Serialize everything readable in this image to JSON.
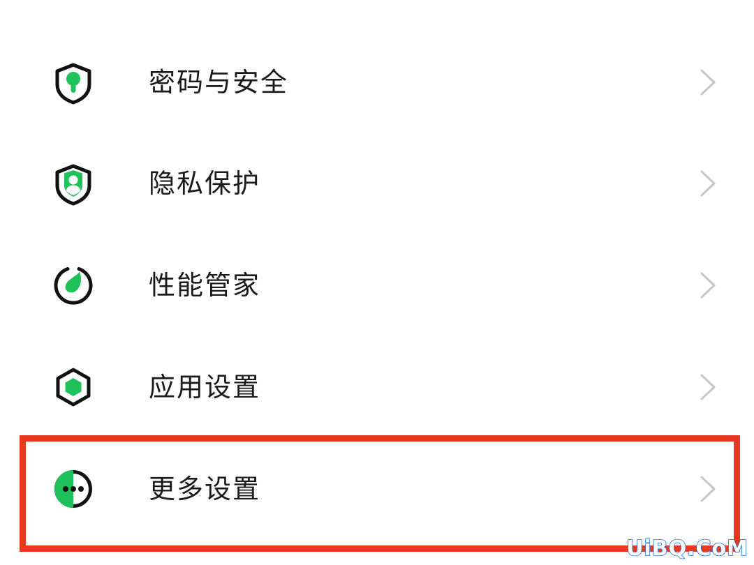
{
  "settings_list": {
    "items": [
      {
        "label": "密码与安全",
        "icon": "shield-keyhole-icon"
      },
      {
        "label": "隐私保护",
        "icon": "shield-person-icon"
      },
      {
        "label": "性能管家",
        "icon": "gauge-leaf-icon"
      },
      {
        "label": "应用设置",
        "icon": "hexagon-icon"
      },
      {
        "label": "更多设置",
        "icon": "more-dots-icon"
      }
    ]
  },
  "highlighted_item": "更多设置",
  "watermark": "UiBQ.CoM",
  "colors": {
    "accent_green": "#1fc15a",
    "icon_dark": "#111111",
    "label_text": "#1a1a1a",
    "chevron": "#c6c6c6",
    "highlight_red": "#e8381f",
    "watermark_blue": "#1f6fd6"
  }
}
